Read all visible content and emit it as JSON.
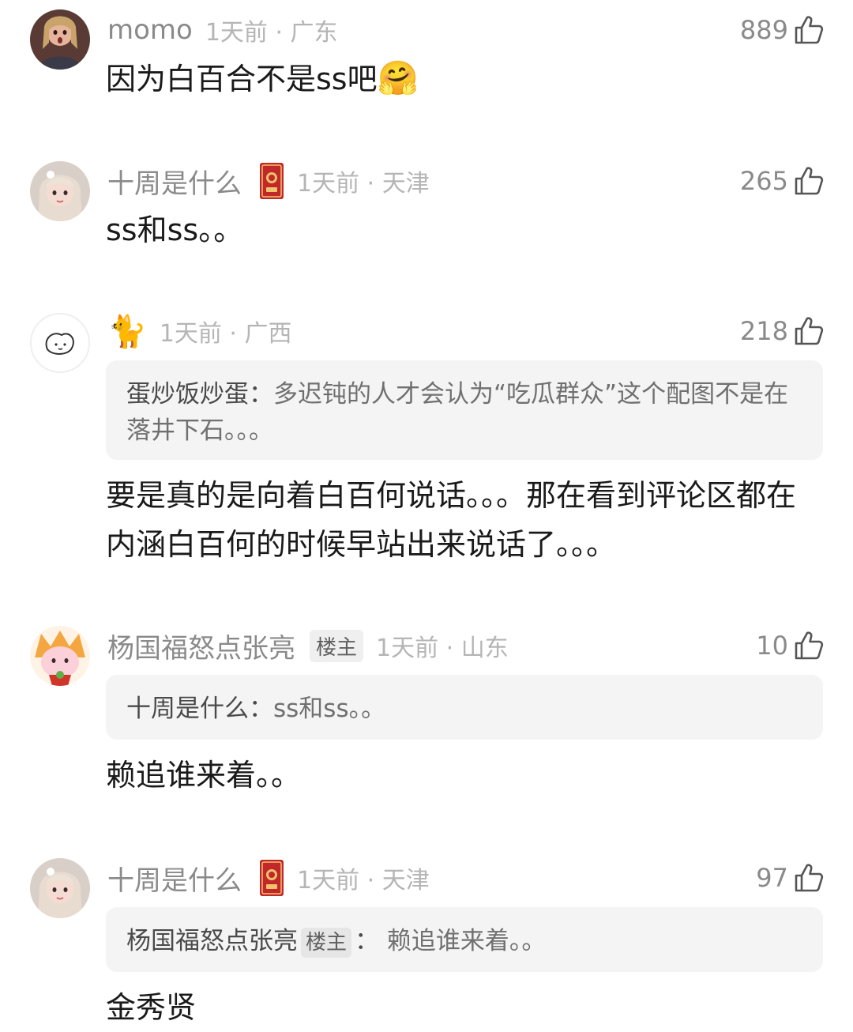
{
  "comments": [
    {
      "username": "momo",
      "time_loc": "1天前 · 广东",
      "likes": "889",
      "text": "因为白百合不是ss吧",
      "emoji": "🤗"
    },
    {
      "username": "十周是什么",
      "time_loc": "1天前 · 天津",
      "likes": "265",
      "text": "ss和ss。。"
    },
    {
      "username": "🐈",
      "time_loc": "1天前 · 广西",
      "likes": "218",
      "quote_name": "蛋炒饭炒蛋：",
      "quote_text": "多迟钝的人才会认为“吃瓜群众”这个配图不是在落井下石。。。",
      "text": "要是真的是向着白百何说话。。。那在看到评论区都在内涵白百何的时候早站出来说话了。。。"
    },
    {
      "username": "杨国福怒点张亮",
      "tag": "楼主",
      "time_loc": "1天前 · 山东",
      "likes": "10",
      "quote_name": "十周是什么：",
      "quote_text": "ss和ss。。",
      "text": "赖追谁来着。。"
    },
    {
      "username": "十周是什么",
      "time_loc": "1天前 · 天津",
      "likes": "97",
      "quote_name": "杨国福怒点张亮",
      "quote_tag": "楼主",
      "quote_sep": "：",
      "quote_text": "赖追谁来着。。",
      "text": "金秀贤"
    }
  ],
  "icons": {
    "like": "thumbs-up-icon",
    "badge": "red-envelope-badge-icon"
  },
  "colors": {
    "username": "#8a8a8a",
    "meta": "#b5b5b5",
    "body": "#1a1a1a",
    "quote_bg": "#f4f4f4",
    "badge_red": "#c0282a"
  }
}
